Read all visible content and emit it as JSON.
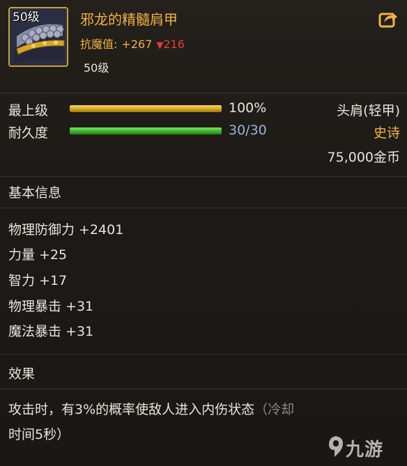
{
  "item": {
    "level_badge": "50级",
    "name": "邪龙的精髓肩甲",
    "resist_label": "抗魔值:",
    "resist_value": "+267",
    "resist_diff": "216",
    "level_text": "50级"
  },
  "bars": {
    "upgrade_label": "最上级",
    "upgrade_value": "100%",
    "upgrade_fraction": 1.0,
    "durability_label": "耐久度",
    "durability_value": "30/30",
    "durability_fraction": 1.0
  },
  "meta": {
    "slot": "头肩(轻甲)",
    "rarity": "史诗",
    "price": "75,000金币"
  },
  "basic_info": {
    "title": "基本信息",
    "stats": [
      "物理防御力 +2401",
      "力量 +25",
      "智力 +17",
      "物理暴击 +31",
      "魔法暴击 +31"
    ]
  },
  "effect": {
    "title": "效果",
    "line1": "攻击时，有3%的概率使敌人进入内伤状态",
    "line1_tail": "（冷却",
    "line2": "时间5秒）"
  },
  "watermark": "九游",
  "colors": {
    "gold": "#f2b33d",
    "red": "#e63a3a",
    "blue_value": "#9db4d8",
    "frame": "#c9a23a"
  },
  "icons": [
    "shoulder-armor-icon",
    "share-icon",
    "down-arrow-icon",
    "jiuyou-logo-icon"
  ]
}
